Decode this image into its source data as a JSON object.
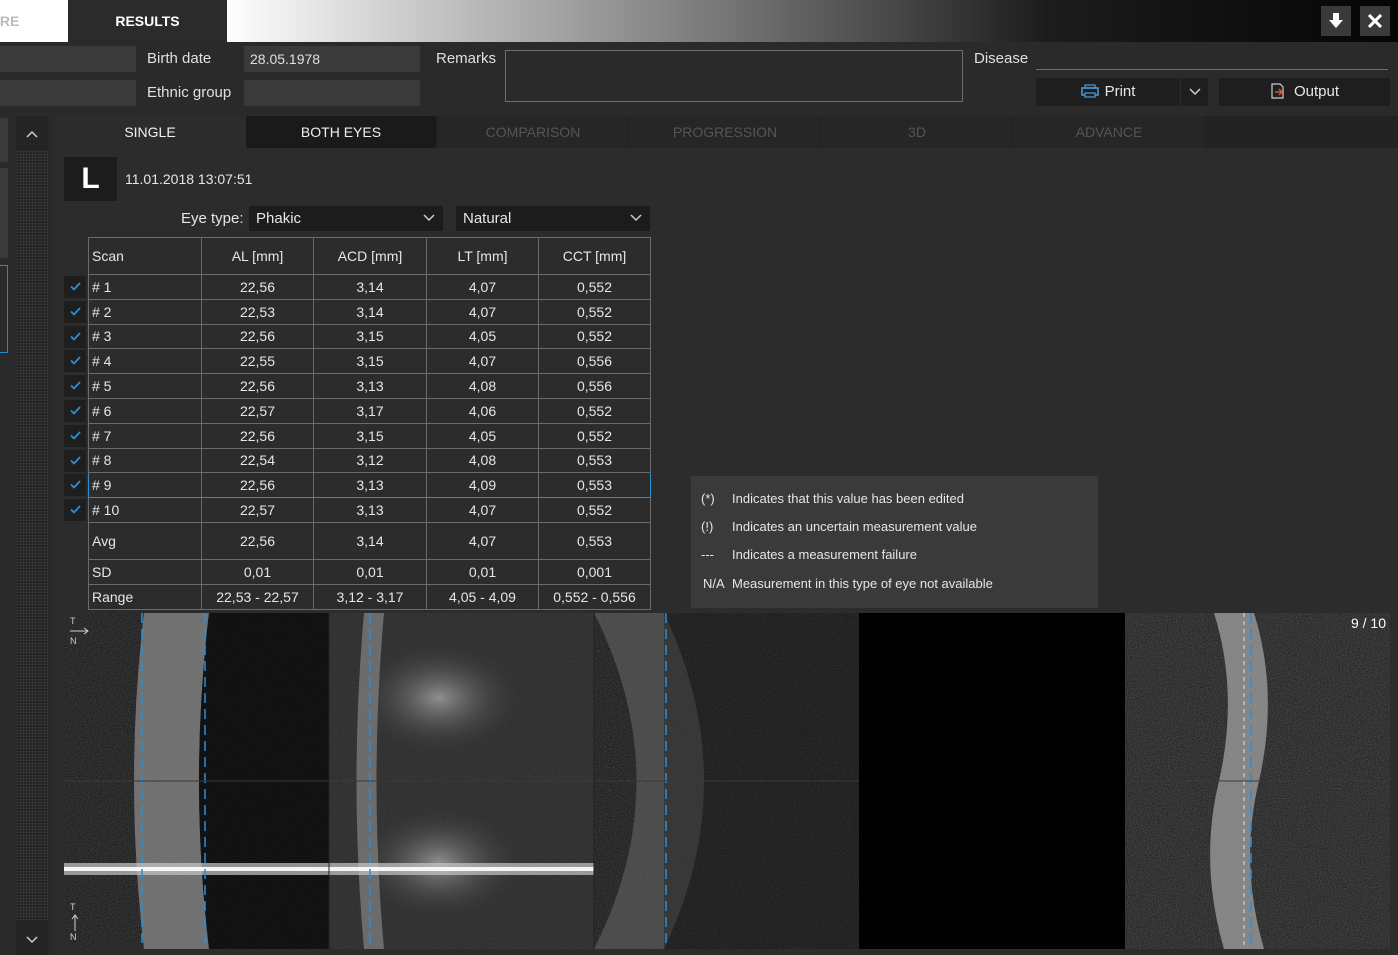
{
  "titlebar": {
    "prev_tab": "IRE",
    "active_tab": "RESULTS"
  },
  "patient": {
    "birth_date_label": "Birth date",
    "birth_date_value": "28.05.1978",
    "ethnic_group_label": "Ethnic group",
    "ethnic_group_value": "",
    "remarks_label": "Remarks",
    "disease_label": "Disease"
  },
  "actions": {
    "print_label": "Print",
    "output_label": "Output"
  },
  "view_tabs": [
    {
      "label": "SINGLE",
      "state": "active"
    },
    {
      "label": "BOTH EYES",
      "state": "normal"
    },
    {
      "label": "COMPARISON",
      "state": "disabled"
    },
    {
      "label": "PROGRESSION",
      "state": "disabled"
    },
    {
      "label": "3D",
      "state": "disabled"
    },
    {
      "label": "ADVANCE",
      "state": "disabled"
    }
  ],
  "exam": {
    "eye": "L",
    "datetime": "11.01.2018 13:07:51",
    "eye_type_label": "Eye type:",
    "eye_type_value": "Phakic",
    "lens_value": "Natural"
  },
  "table": {
    "headers": [
      "Scan",
      "AL [mm]",
      "ACD [mm]",
      "LT [mm]",
      "CCT [mm]"
    ],
    "rows": [
      [
        "# 1",
        "22,56",
        "3,14",
        "4,07",
        "0,552"
      ],
      [
        "# 2",
        "22,53",
        "3,14",
        "4,07",
        "0,552"
      ],
      [
        "# 3",
        "22,56",
        "3,15",
        "4,05",
        "0,552"
      ],
      [
        "# 4",
        "22,55",
        "3,15",
        "4,07",
        "0,556"
      ],
      [
        "# 5",
        "22,56",
        "3,13",
        "4,08",
        "0,556"
      ],
      [
        "# 6",
        "22,57",
        "3,17",
        "4,06",
        "0,552"
      ],
      [
        "# 7",
        "22,56",
        "3,15",
        "4,05",
        "0,552"
      ],
      [
        "# 8",
        "22,54",
        "3,12",
        "4,08",
        "0,553"
      ],
      [
        "# 9",
        "22,56",
        "3,13",
        "4,09",
        "0,553"
      ],
      [
        "# 10",
        "22,57",
        "3,13",
        "4,07",
        "0,552"
      ]
    ],
    "selected_row": 8,
    "summary": [
      [
        "Avg",
        "22,56",
        "3,14",
        "4,07",
        "0,553"
      ],
      [
        "SD",
        "0,01",
        "0,01",
        "0,01",
        "0,001"
      ],
      [
        "Range",
        "22,53 - 22,57",
        "3,12 - 3,17",
        "4,05 - 4,09",
        "0,552 - 0,556"
      ]
    ]
  },
  "legend": [
    {
      "symbol": "(*)",
      "text": "Indicates that this value has been edited"
    },
    {
      "symbol": "(!)",
      "text": "Indicates an uncertain measurement value"
    },
    {
      "symbol": "---",
      "text": "Indicates a measurement failure"
    },
    {
      "symbol": "N/A",
      "text": "Measurement in this type of eye not available"
    }
  ],
  "images": {
    "frame_counter": "9 / 10",
    "orientation_top": [
      "T",
      "N"
    ],
    "orientation_bottom": [
      "T",
      "N"
    ]
  },
  "colors": {
    "accent": "#2a8fd4",
    "background": "#2a2a2a",
    "panel": "#3a3a3a"
  }
}
